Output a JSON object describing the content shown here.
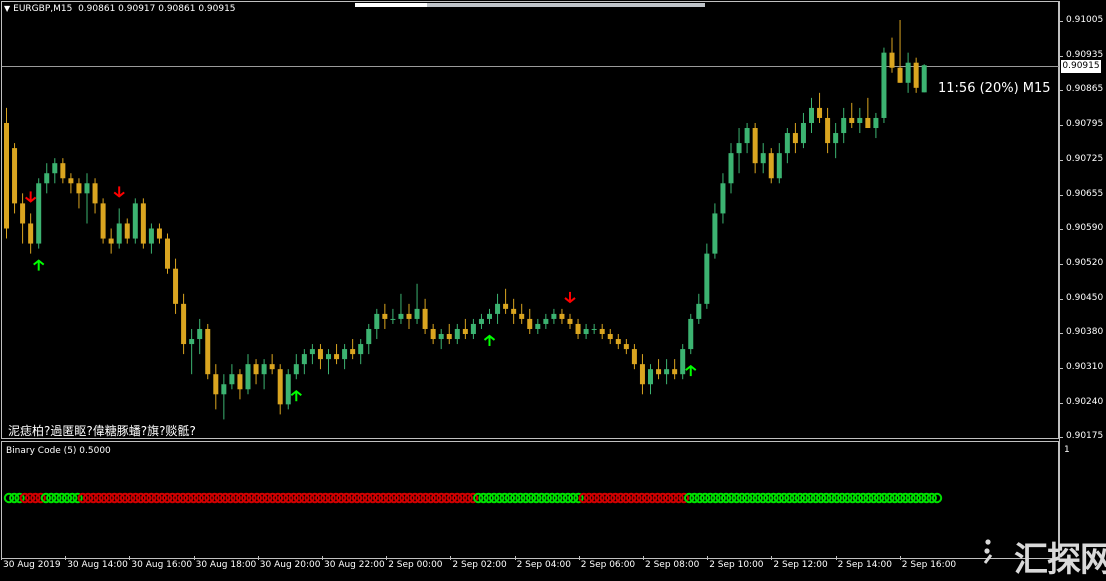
{
  "chart_header": {
    "symbol": "EURGBP,M15",
    "ohlc": "0.90861 0.90917 0.90861 0.90915"
  },
  "timer": "11:56 (20%) M15",
  "current_price": "0.90915",
  "garbled_text": "泥痣柏?過匿眍?偉糖豚蟠?旗?赕骶?",
  "indicator": {
    "title": "Binary Code (5) 0.5000",
    "max_label": "1"
  },
  "price_axis": [
    "0.91005",
    "0.90935",
    "0.90865",
    "0.90795",
    "0.90725",
    "0.90655",
    "0.90590",
    "0.90520",
    "0.90450",
    "0.90380",
    "0.90310",
    "0.90240",
    "0.90175"
  ],
  "time_axis": [
    "30 Aug 2019",
    "30 Aug 14:00",
    "30 Aug 16:00",
    "30 Aug 18:00",
    "30 Aug 20:00",
    "30 Aug 22:00",
    "2 Sep 00:00",
    "2 Sep 02:00",
    "2 Sep 04:00",
    "2 Sep 06:00",
    "2 Sep 08:00",
    "2 Sep 10:00",
    "2 Sep 12:00",
    "2 Sep 14:00",
    "2 Sep 16:00"
  ],
  "colors": {
    "bull": "#3cb371",
    "bear": "#daa520",
    "arrow_up": "#00ff00",
    "arrow_down": "#ff0000",
    "dot_green": "#00e000",
    "dot_red": "#d00000"
  },
  "watermark": "汇探网",
  "chart_data": {
    "type": "candlestick",
    "symbol": "EURGBP",
    "timeframe": "M15",
    "ylim": [
      0.90175,
      0.91005
    ],
    "candles": [
      [
        0.908,
        0.9083,
        0.9057,
        0.9059
      ],
      [
        0.9075,
        0.9076,
        0.9062,
        0.9064
      ],
      [
        0.9064,
        0.9066,
        0.9056,
        0.906
      ],
      [
        0.906,
        0.9062,
        0.9054,
        0.9056
      ],
      [
        0.9056,
        0.9069,
        0.9055,
        0.9068
      ],
      [
        0.9068,
        0.9072,
        0.9066,
        0.907
      ],
      [
        0.907,
        0.9073,
        0.9068,
        0.9072
      ],
      [
        0.9072,
        0.9073,
        0.9068,
        0.9069
      ],
      [
        0.9069,
        0.907,
        0.9066,
        0.9068
      ],
      [
        0.9068,
        0.9069,
        0.9063,
        0.9066
      ],
      [
        0.9066,
        0.907,
        0.906,
        0.9068
      ],
      [
        0.9068,
        0.9069,
        0.9062,
        0.9064
      ],
      [
        0.9064,
        0.9065,
        0.9056,
        0.9057
      ],
      [
        0.9057,
        0.9059,
        0.9054,
        0.9056
      ],
      [
        0.9056,
        0.9063,
        0.9055,
        0.906
      ],
      [
        0.906,
        0.9061,
        0.9056,
        0.9057
      ],
      [
        0.9057,
        0.9065,
        0.9056,
        0.9064
      ],
      [
        0.9064,
        0.9065,
        0.9055,
        0.9056
      ],
      [
        0.9056,
        0.906,
        0.9054,
        0.9059
      ],
      [
        0.9059,
        0.906,
        0.9056,
        0.9057
      ],
      [
        0.9057,
        0.9058,
        0.905,
        0.9051
      ],
      [
        0.9051,
        0.9053,
        0.9042,
        0.9044
      ],
      [
        0.9044,
        0.9046,
        0.9034,
        0.9036
      ],
      [
        0.9036,
        0.9039,
        0.903,
        0.9037
      ],
      [
        0.9037,
        0.9041,
        0.9034,
        0.9039
      ],
      [
        0.9039,
        0.904,
        0.9029,
        0.903
      ],
      [
        0.903,
        0.9032,
        0.9023,
        0.9026
      ],
      [
        0.9026,
        0.903,
        0.9021,
        0.9028
      ],
      [
        0.9028,
        0.9032,
        0.9027,
        0.903
      ],
      [
        0.903,
        0.9031,
        0.9025,
        0.9027
      ],
      [
        0.9027,
        0.9034,
        0.9026,
        0.9032
      ],
      [
        0.9032,
        0.9033,
        0.9028,
        0.903
      ],
      [
        0.903,
        0.9033,
        0.9027,
        0.9032
      ],
      [
        0.9032,
        0.9034,
        0.903,
        0.9031
      ],
      [
        0.9031,
        0.9032,
        0.9022,
        0.9024
      ],
      [
        0.9024,
        0.9031,
        0.9023,
        0.903
      ],
      [
        0.903,
        0.9034,
        0.9029,
        0.9032
      ],
      [
        0.9032,
        0.9035,
        0.903,
        0.9034
      ],
      [
        0.9034,
        0.9036,
        0.9032,
        0.9035
      ],
      [
        0.9035,
        0.9036,
        0.9031,
        0.9033
      ],
      [
        0.9033,
        0.9035,
        0.903,
        0.9034
      ],
      [
        0.9034,
        0.9036,
        0.9032,
        0.9033
      ],
      [
        0.9033,
        0.9036,
        0.9031,
        0.9035
      ],
      [
        0.9035,
        0.9037,
        0.9033,
        0.9034
      ],
      [
        0.9034,
        0.9037,
        0.9032,
        0.9036
      ],
      [
        0.9036,
        0.904,
        0.9034,
        0.9039
      ],
      [
        0.9039,
        0.9043,
        0.9037,
        0.9042
      ],
      [
        0.9042,
        0.9044,
        0.9039,
        0.9041
      ],
      [
        0.9041,
        0.9043,
        0.904,
        0.9041
      ],
      [
        0.9041,
        0.9046,
        0.904,
        0.9042
      ],
      [
        0.9042,
        0.9044,
        0.9039,
        0.9041
      ],
      [
        0.9041,
        0.9048,
        0.904,
        0.9043
      ],
      [
        0.9043,
        0.9045,
        0.9038,
        0.9039
      ],
      [
        0.9039,
        0.904,
        0.9036,
        0.9037
      ],
      [
        0.9037,
        0.9039,
        0.9035,
        0.9038
      ],
      [
        0.9038,
        0.904,
        0.9036,
        0.9037
      ],
      [
        0.9037,
        0.904,
        0.9036,
        0.9039
      ],
      [
        0.9039,
        0.9041,
        0.9037,
        0.9038
      ],
      [
        0.9038,
        0.9041,
        0.9037,
        0.904
      ],
      [
        0.904,
        0.9042,
        0.9039,
        0.9041
      ],
      [
        0.9041,
        0.9043,
        0.904,
        0.9042
      ],
      [
        0.9042,
        0.9046,
        0.904,
        0.9044
      ],
      [
        0.9044,
        0.9047,
        0.9042,
        0.9043
      ],
      [
        0.9043,
        0.9045,
        0.904,
        0.9042
      ],
      [
        0.9042,
        0.9044,
        0.904,
        0.9041
      ],
      [
        0.9041,
        0.9043,
        0.9038,
        0.9039
      ],
      [
        0.9039,
        0.9041,
        0.9038,
        0.904
      ],
      [
        0.904,
        0.9042,
        0.9039,
        0.9041
      ],
      [
        0.9041,
        0.9043,
        0.904,
        0.9042
      ],
      [
        0.9042,
        0.9043,
        0.904,
        0.9041
      ],
      [
        0.9041,
        0.9042,
        0.9039,
        0.904
      ],
      [
        0.904,
        0.9041,
        0.9037,
        0.9038
      ],
      [
        0.9038,
        0.904,
        0.9037,
        0.9039
      ],
      [
        0.9039,
        0.904,
        0.9038,
        0.9039
      ],
      [
        0.9039,
        0.904,
        0.9037,
        0.9038
      ],
      [
        0.9038,
        0.9039,
        0.9036,
        0.9037
      ],
      [
        0.9037,
        0.9038,
        0.9035,
        0.9036
      ],
      [
        0.9036,
        0.9037,
        0.9034,
        0.9035
      ],
      [
        0.9035,
        0.9036,
        0.9031,
        0.9032
      ],
      [
        0.9032,
        0.9034,
        0.9026,
        0.9028
      ],
      [
        0.9028,
        0.9032,
        0.9026,
        0.9031
      ],
      [
        0.9031,
        0.9033,
        0.9029,
        0.903
      ],
      [
        0.903,
        0.9033,
        0.9028,
        0.9031
      ],
      [
        0.9031,
        0.9033,
        0.9029,
        0.903
      ],
      [
        0.903,
        0.9036,
        0.9029,
        0.9035
      ],
      [
        0.9035,
        0.9042,
        0.9034,
        0.9041
      ],
      [
        0.9041,
        0.9046,
        0.904,
        0.9044
      ],
      [
        0.9044,
        0.9056,
        0.9043,
        0.9054
      ],
      [
        0.9054,
        0.9064,
        0.9053,
        0.9062
      ],
      [
        0.9062,
        0.907,
        0.906,
        0.9068
      ],
      [
        0.9068,
        0.9076,
        0.9066,
        0.9074
      ],
      [
        0.9074,
        0.9079,
        0.907,
        0.9076
      ],
      [
        0.9076,
        0.908,
        0.9074,
        0.9079
      ],
      [
        0.9079,
        0.908,
        0.907,
        0.9072
      ],
      [
        0.9072,
        0.9076,
        0.907,
        0.9074
      ],
      [
        0.9074,
        0.9075,
        0.9068,
        0.9069
      ],
      [
        0.9069,
        0.9076,
        0.9068,
        0.9074
      ],
      [
        0.9074,
        0.9079,
        0.9072,
        0.9078
      ],
      [
        0.9078,
        0.908,
        0.9074,
        0.9076
      ],
      [
        0.9076,
        0.9082,
        0.9075,
        0.908
      ],
      [
        0.908,
        0.9085,
        0.9078,
        0.9083
      ],
      [
        0.9083,
        0.9086,
        0.908,
        0.9081
      ],
      [
        0.9081,
        0.9083,
        0.9074,
        0.9076
      ],
      [
        0.9076,
        0.908,
        0.9073,
        0.9078
      ],
      [
        0.9078,
        0.9083,
        0.9076,
        0.9081
      ],
      [
        0.9081,
        0.9084,
        0.9079,
        0.908
      ],
      [
        0.908,
        0.9083,
        0.9078,
        0.9081
      ],
      [
        0.9081,
        0.9085,
        0.9079,
        0.9079
      ],
      [
        0.9079,
        0.9082,
        0.9077,
        0.9081
      ],
      [
        0.9081,
        0.9095,
        0.908,
        0.9094
      ],
      [
        0.9094,
        0.9097,
        0.909,
        0.9091
      ],
      [
        0.9091,
        0.91005,
        0.9088,
        0.9088
      ],
      [
        0.9088,
        0.9094,
        0.9086,
        0.9092
      ],
      [
        0.9092,
        0.9093,
        0.9086,
        0.9087
      ],
      [
        0.90861,
        0.90917,
        0.90861,
        0.90915
      ]
    ],
    "signals_up": [
      4,
      36,
      60,
      85
    ],
    "signals_down": [
      3,
      14,
      70
    ],
    "binary_code": "GGGRRRRGGGGGGGRRRRRRRRRRRRRRRRRRRRRRRRRRRRRRRRRRRRRRRRRRRRRRRRRRRRRRRRRRRRRRRRRRRRRRRRRRRGGGGGGGGGGGGGGGGGGGGRRRRRRRRRRRRRRRRRRRRGGGGGGGGGGGGGGGGGGGGGGGGGGGGGGGGGGGGGGGGGGGGGGGG"
  }
}
